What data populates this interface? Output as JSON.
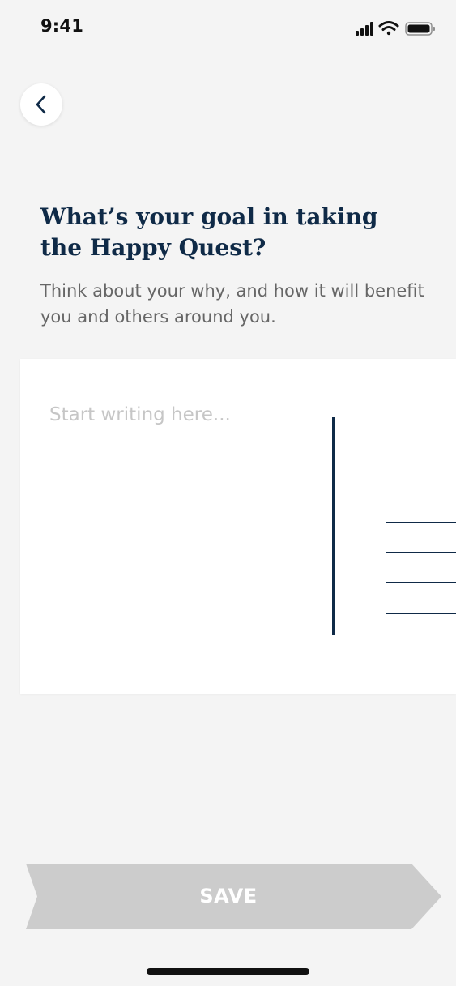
{
  "status_bar": {
    "time": "9:41",
    "icons": [
      "cellular-signal-icon",
      "wifi-icon",
      "battery-icon"
    ]
  },
  "header": {
    "back_icon": "chevron-left-icon"
  },
  "prompt": {
    "title": "What’s your goal in taking the Happy Quest?",
    "subtitle": "Think about your why, and how it will benefit you and others around you."
  },
  "editor": {
    "placeholder": "Start writing here...",
    "value": ""
  },
  "footer": {
    "save_label": "SAVE"
  },
  "colors": {
    "background": "#f4f4f4",
    "title": "#0f2a47",
    "subtitle": "#666666",
    "placeholder": "#c6c6c6",
    "save_button": "#cccccc",
    "save_text": "#ffffff"
  }
}
